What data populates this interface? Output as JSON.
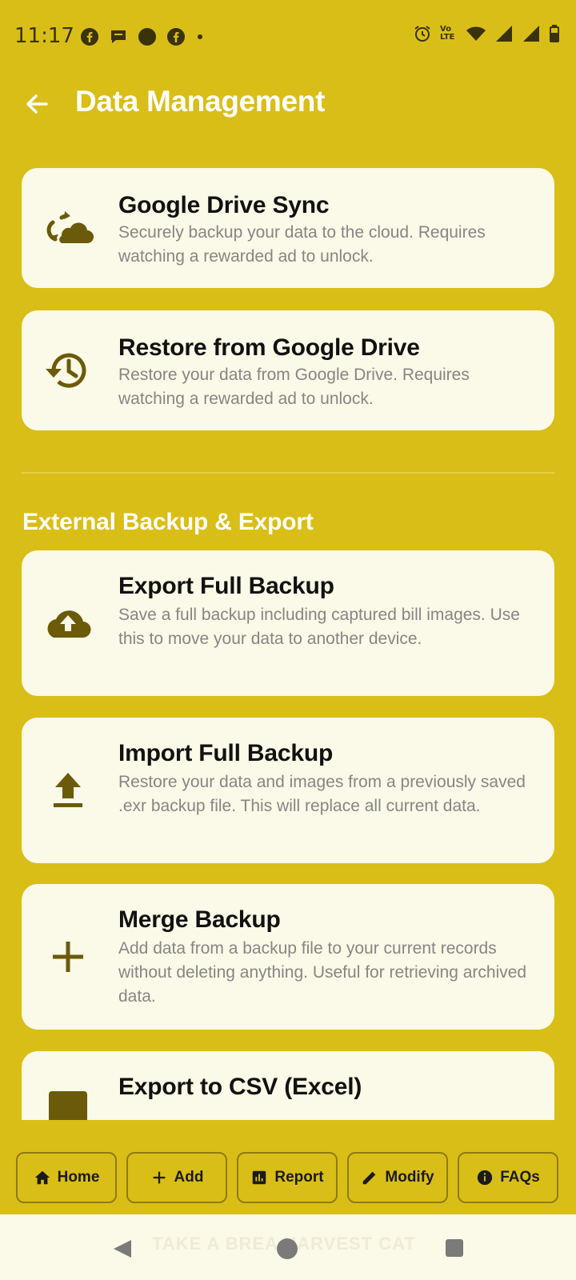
{
  "status_bar": {
    "time": "11:17",
    "notification_icons": [
      "facebook-icon",
      "chat-bubble-icon",
      "circle-icon",
      "facebook-icon",
      "dot-icon"
    ],
    "right_icons": [
      "alarm-icon",
      "volte-icon",
      "wifi-icon",
      "signal-icon",
      "signal-icon",
      "battery-icon"
    ],
    "volte_label": "Vo LTE"
  },
  "app_bar": {
    "title": "Data Management",
    "back_icon": "arrow-back-icon"
  },
  "cards": [
    {
      "title": "Google Drive Sync",
      "description": "Securely backup your data to the cloud. Requires watching a rewarded ad to unlock.",
      "icon": "cloud-sync-icon"
    },
    {
      "title": "Restore from Google Drive",
      "description": "Restore your data from Google Drive. Requires watching a rewarded ad to unlock.",
      "icon": "restore-history-icon"
    }
  ],
  "section": {
    "heading": "External Backup & Export"
  },
  "external_cards": [
    {
      "title": "Export Full Backup",
      "description": "Save a full backup including captured bill images. Use this to move your data to another device.",
      "icon": "cloud-upload-icon"
    },
    {
      "title": "Import Full Backup",
      "description": "Restore your data and images from a previously saved .exr backup file. This will replace all current data.",
      "icon": "upload-icon"
    },
    {
      "title": "Merge Backup",
      "description": "Add data from a backup file to your current records without deleting anything. Useful for retrieving archived data.",
      "icon": "plus-icon"
    },
    {
      "title": "Export to CSV (Excel)",
      "description": "",
      "icon": "table-icon"
    }
  ],
  "bottom_nav": [
    {
      "label": "Home",
      "icon": "home-icon"
    },
    {
      "label": "Add",
      "icon": "plus-icon"
    },
    {
      "label": "Report",
      "icon": "bar-chart-icon"
    },
    {
      "label": "Modify",
      "icon": "pencil-icon"
    },
    {
      "label": "FAQs",
      "icon": "info-icon"
    }
  ],
  "system_bar": {
    "ghost_text": "TAKE A BREA    HARVEST CAT"
  },
  "colors": {
    "background": "#D9BE17",
    "card": "#FBF9E7",
    "icon": "#6B5A0A",
    "title_text": "#FFFFFF",
    "description_text": "#868686"
  }
}
